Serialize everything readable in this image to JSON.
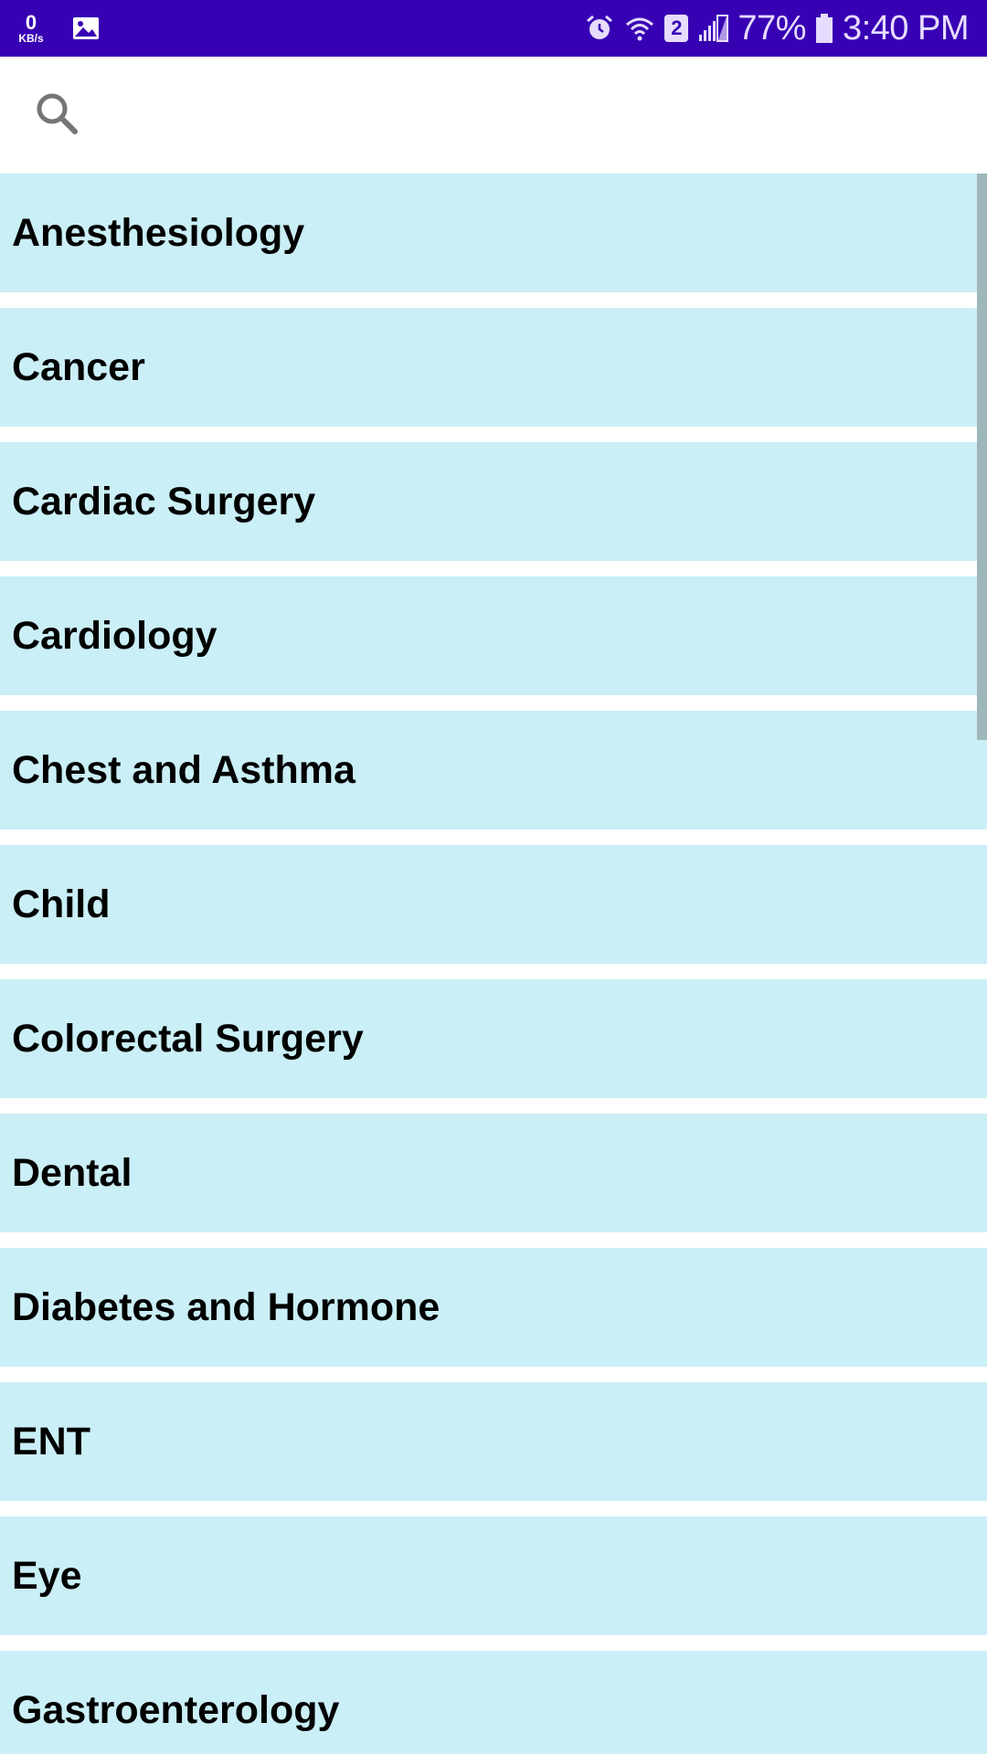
{
  "status_bar": {
    "net_speed_value": "0",
    "net_speed_unit": "KB/s",
    "sim_badge": "2",
    "battery_percent": "77%",
    "time": "3:40 PM",
    "background_color": "#3700b3",
    "icons": [
      "gallery-icon",
      "alarm-icon",
      "wifi-icon",
      "signal-icon",
      "battery-icon"
    ]
  },
  "search": {
    "placeholder": "",
    "value": "",
    "icon": "search-icon"
  },
  "list": {
    "item_background": "#caeff6",
    "items": [
      {
        "label": "Anesthesiology"
      },
      {
        "label": "Cancer"
      },
      {
        "label": "Cardiac Surgery"
      },
      {
        "label": "Cardiology"
      },
      {
        "label": "Chest and Asthma"
      },
      {
        "label": "Child"
      },
      {
        "label": "Colorectal Surgery"
      },
      {
        "label": "Dental"
      },
      {
        "label": "Diabetes and Hormone"
      },
      {
        "label": "ENT"
      },
      {
        "label": "Eye"
      },
      {
        "label": "Gastroenterology"
      }
    ]
  }
}
